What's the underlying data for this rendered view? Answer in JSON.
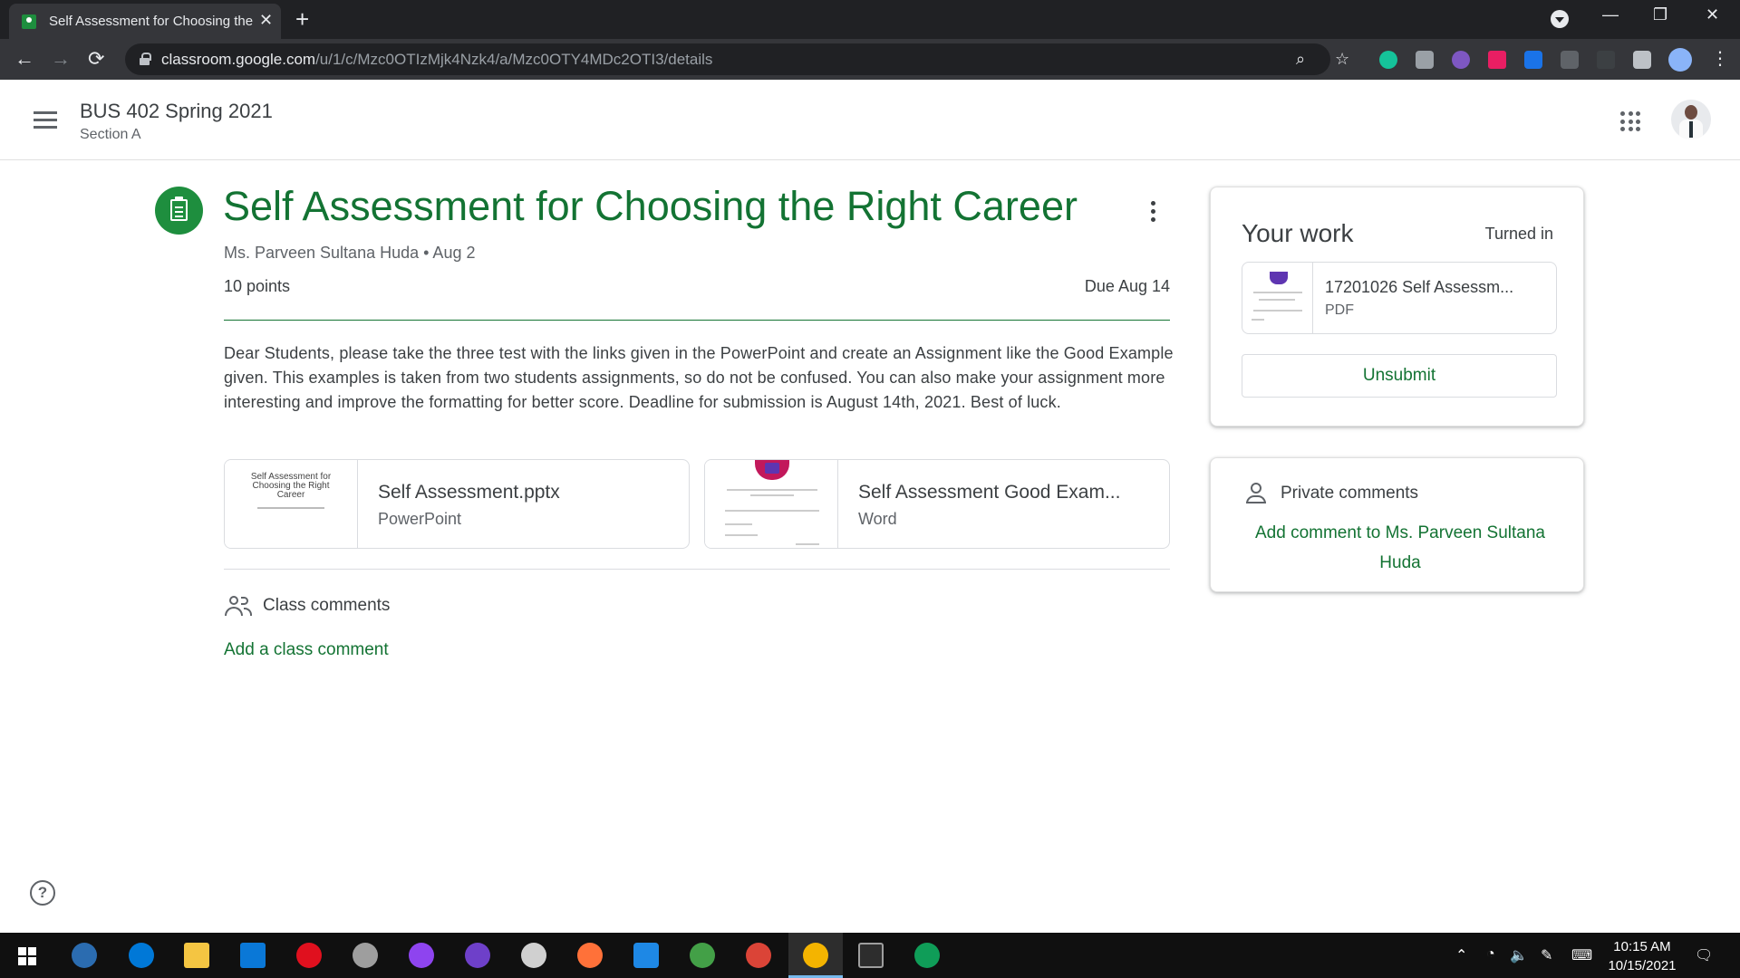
{
  "browser": {
    "tab_title": "Self Assessment for Choosing the Right Career",
    "tab_close": "✕",
    "new_tab": "+",
    "url_host": "classroom.google.com",
    "url_path": "/u/1/c/Mzc0OTIzMjk4Nzk4/a/Mzc0OTY4MDc2OTI3/details",
    "back": "←",
    "forward": "→",
    "reload": "⟳",
    "minimize": "—",
    "restore": "❐",
    "close": "✕"
  },
  "header": {
    "course_title": "BUS 402 Spring 2021",
    "section": "Section A"
  },
  "assignment": {
    "title": "Self Assessment for Choosing the Right Career",
    "meta": "Ms. Parveen Sultana Huda • Aug 2",
    "points": "10 points",
    "due": "Due Aug 14",
    "description": "Dear Students, please take the three test with the links given in the PowerPoint and create an Assignment like the Good Example given. This examples is taken from two students assignments, so do not be confused. You can also make your assignment more interesting and improve the formatting for better score. Deadline for submission is August 14th, 2021. Best of luck.",
    "attachments": [
      {
        "name": "Self Assessment.pptx",
        "type": "PowerPoint",
        "thumb_text": "Self Assessment for Choosing the Right Career"
      },
      {
        "name": "Self Assessment Good Exam...",
        "type": "Word"
      }
    ]
  },
  "class_comments": {
    "heading": "Class comments",
    "add_link": "Add a class comment"
  },
  "your_work": {
    "title": "Your work",
    "status": "Turned in",
    "file_name": "17201026 Self Assessm...",
    "file_type": "PDF",
    "unsubmit_label": "Unsubmit"
  },
  "private_comments": {
    "heading": "Private comments",
    "add_link": "Add comment to Ms. Parveen Sultana Huda"
  },
  "help_label": "?",
  "taskbar": {
    "time": "10:15 AM",
    "date": "10/15/2021"
  },
  "colors": {
    "classroom_green": "#137333",
    "icon_green": "#1e8e3e",
    "chrome_dark": "#202124"
  }
}
